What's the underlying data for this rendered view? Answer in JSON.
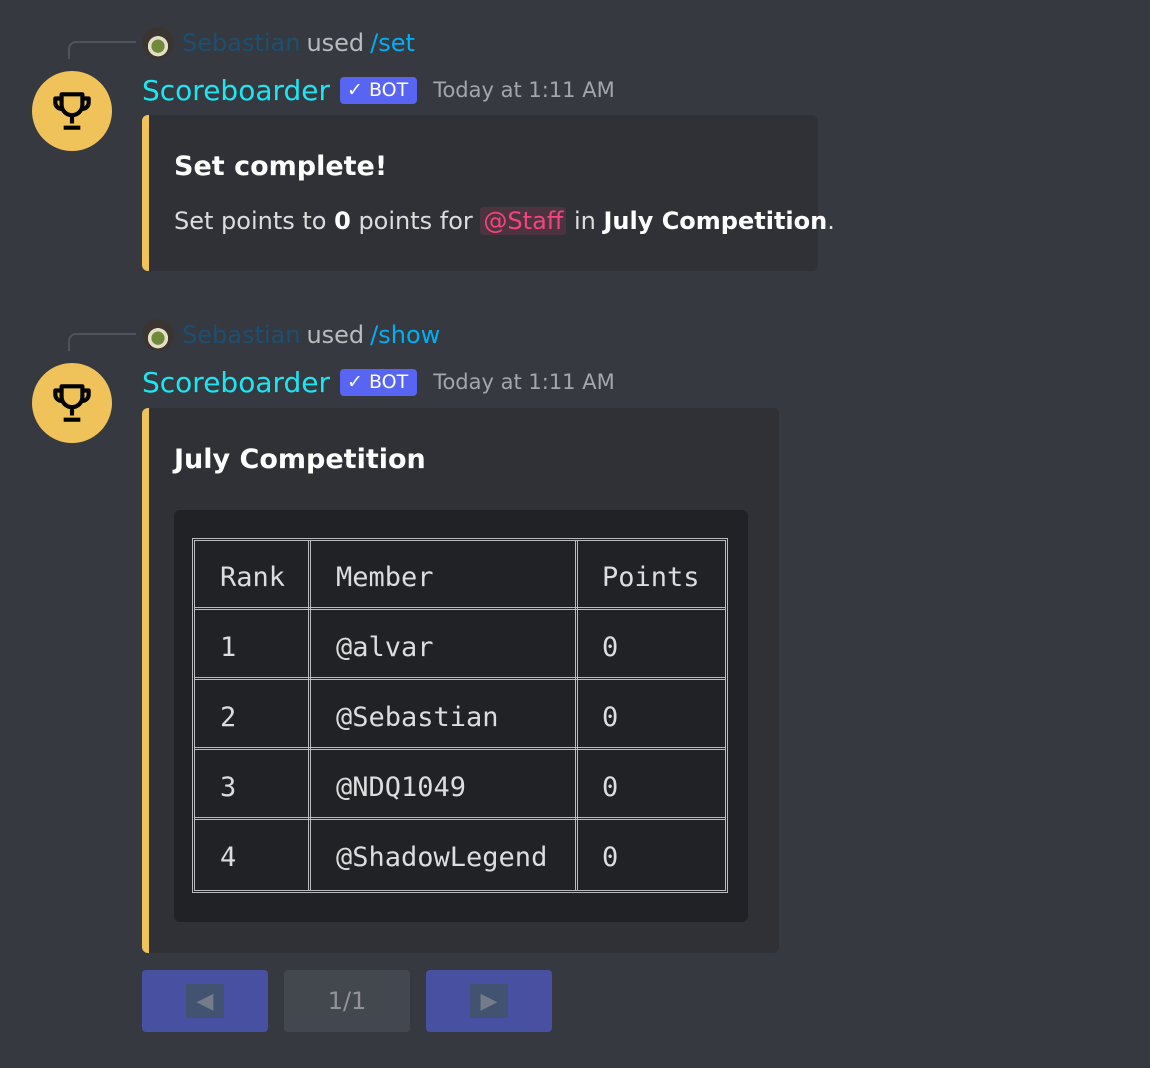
{
  "messages": [
    {
      "reply": {
        "user": "Sebastian",
        "used": "used",
        "command": "/set"
      },
      "author": {
        "name": "Scoreboarder",
        "badge": "BOT",
        "badge_check": "✓",
        "timestamp": "Today at 1:11 AM",
        "avatar_icon": "trophy-icon"
      },
      "embed": {
        "title": "Set complete!",
        "desc_prefix": "Set points to ",
        "desc_value": "0",
        "desc_mid": " points for ",
        "desc_mention": "@Staff",
        "desc_in": " in ",
        "desc_competition": "July Competition",
        "desc_end": ".",
        "accent_color": "#f0c35a"
      }
    },
    {
      "reply": {
        "user": "Sebastian",
        "used": "used",
        "command": "/show"
      },
      "author": {
        "name": "Scoreboarder",
        "badge": "BOT",
        "badge_check": "✓",
        "timestamp": "Today at 1:11 AM",
        "avatar_icon": "trophy-icon"
      },
      "embed": {
        "title": "July Competition",
        "table": {
          "headers": [
            "Rank",
            "Member",
            "Points"
          ],
          "rows": [
            [
              "1",
              "@alvar",
              "0"
            ],
            [
              "2",
              "@Sebastian",
              "0"
            ],
            [
              "3",
              "@NDQ1049",
              "0"
            ],
            [
              "4",
              "@ShadowLegend",
              "0"
            ]
          ]
        }
      }
    }
  ],
  "pagination": {
    "prev_icon": "left-triangle-icon",
    "page": "1/1",
    "next_icon": "right-triangle-icon"
  },
  "colors": {
    "background": "#36393f",
    "embed_bg": "#2f3136",
    "accent": "#f0c35a",
    "bot_name": "#1de6f2",
    "badge": "#5865f2",
    "mention": "#f2457d",
    "command": "#00aff4"
  }
}
